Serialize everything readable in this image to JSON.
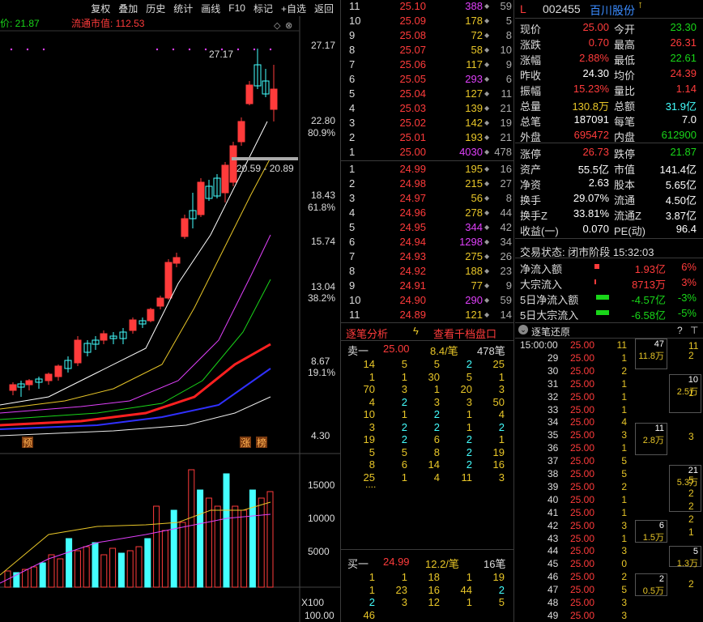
{
  "toolbar": [
    "复权",
    "叠加",
    "历史",
    "统计",
    "画线",
    "F10",
    "标记",
    "+自选",
    "返回"
  ],
  "chart": {
    "left_label": "价: 21.87",
    "market_cap_label": "流通市值: 112.53",
    "price_axis": [
      "27.17",
      "22.80",
      "18.43",
      "15.74",
      "13.04",
      "8.67",
      "4.30"
    ],
    "pct_axis": [
      "80.9%",
      "61.8%",
      "38.2%",
      "19.1%"
    ],
    "high_note": "27.17",
    "range_note": "20.59 - 20.89",
    "tags": [
      "预",
      "涨",
      "榜"
    ],
    "vol_axis": [
      "15000",
      "10000",
      "5000"
    ],
    "vol_unit": "X100",
    "osc_axis": "100.00"
  },
  "orderbook": {
    "asks": [
      {
        "lvl": "11",
        "px": "25.10",
        "vol": "388",
        "c": "59",
        "vc": "mag"
      },
      {
        "lvl": "10",
        "px": "25.09",
        "vol": "178",
        "c": "5",
        "vc": "yel"
      },
      {
        "lvl": "9",
        "px": "25.08",
        "vol": "72",
        "c": "8",
        "vc": "yel"
      },
      {
        "lvl": "8",
        "px": "25.07",
        "vol": "58",
        "c": "10",
        "vc": "yel"
      },
      {
        "lvl": "7",
        "px": "25.06",
        "vol": "117",
        "c": "9",
        "vc": "yel"
      },
      {
        "lvl": "6",
        "px": "25.05",
        "vol": "293",
        "c": "6",
        "vc": "mag"
      },
      {
        "lvl": "5",
        "px": "25.04",
        "vol": "127",
        "c": "11",
        "vc": "yel"
      },
      {
        "lvl": "4",
        "px": "25.03",
        "vol": "139",
        "c": "21",
        "vc": "yel"
      },
      {
        "lvl": "3",
        "px": "25.02",
        "vol": "142",
        "c": "19",
        "vc": "yel"
      },
      {
        "lvl": "2",
        "px": "25.01",
        "vol": "193",
        "c": "21",
        "vc": "yel"
      },
      {
        "lvl": "1",
        "px": "25.00",
        "vol": "4030",
        "c": "478",
        "vc": "mag"
      }
    ],
    "bids": [
      {
        "lvl": "1",
        "px": "24.99",
        "vol": "195",
        "c": "16",
        "vc": "yel"
      },
      {
        "lvl": "2",
        "px": "24.98",
        "vol": "215",
        "c": "27",
        "vc": "yel"
      },
      {
        "lvl": "3",
        "px": "24.97",
        "vol": "56",
        "c": "8",
        "vc": "yel"
      },
      {
        "lvl": "4",
        "px": "24.96",
        "vol": "278",
        "c": "44",
        "vc": "yel"
      },
      {
        "lvl": "5",
        "px": "24.95",
        "vol": "344",
        "c": "42",
        "vc": "mag"
      },
      {
        "lvl": "6",
        "px": "24.94",
        "vol": "1298",
        "c": "34",
        "vc": "mag"
      },
      {
        "lvl": "7",
        "px": "24.93",
        "vol": "275",
        "c": "26",
        "vc": "yel"
      },
      {
        "lvl": "8",
        "px": "24.92",
        "vol": "188",
        "c": "23",
        "vc": "yel"
      },
      {
        "lvl": "9",
        "px": "24.91",
        "vol": "77",
        "c": "9",
        "vc": "yel"
      },
      {
        "lvl": "10",
        "px": "24.90",
        "vol": "290",
        "c": "59",
        "vc": "mag"
      },
      {
        "lvl": "11",
        "px": "24.89",
        "vol": "121",
        "c": "14",
        "vc": "yel"
      }
    ]
  },
  "stats": {
    "badge": "L",
    "code": "002455",
    "name": "百川股份",
    "rows": [
      [
        "现价",
        "25.00",
        "red",
        "今开",
        "23.30",
        "grn"
      ],
      [
        "涨跌",
        "0.70",
        "red",
        "最高",
        "26.31",
        "red"
      ],
      [
        "涨幅",
        "2.88%",
        "red",
        "最低",
        "22.61",
        "grn"
      ],
      [
        "昨收",
        "24.30",
        "wht",
        "均价",
        "24.39",
        "red"
      ],
      [
        "振幅",
        "15.23%",
        "red",
        "量比",
        "1.14",
        "red"
      ],
      [
        "总量",
        "130.8万",
        "yel",
        "总额",
        "31.9亿",
        "cyn"
      ],
      [
        "总笔",
        "187091",
        "wht",
        "每笔",
        "7.0",
        "wht"
      ],
      [
        "外盘",
        "695472",
        "red",
        "内盘",
        "612900",
        "grn"
      ],
      [
        "涨停",
        "26.73",
        "red",
        "跌停",
        "21.87",
        "grn"
      ],
      [
        "资产",
        "55.5亿",
        "wht",
        "市值",
        "141.4亿",
        "wht"
      ],
      [
        "净资",
        "2.63",
        "wht",
        "股本",
        "5.65亿",
        "wht"
      ],
      [
        "换手",
        "29.07%",
        "wht",
        "流通",
        "4.50亿",
        "wht"
      ],
      [
        "换手Z",
        "33.81%",
        "wht",
        "流通Z",
        "3.87亿",
        "wht"
      ],
      [
        "收益(一)",
        "0.070",
        "wht",
        "PE(动)",
        "96.4",
        "wht"
      ]
    ],
    "trade_status": "交易状态: 闭市阶段 15:32:03",
    "flows": [
      [
        "净流入额",
        "1.93亿",
        "6%",
        "red"
      ],
      [
        "大宗流入",
        "8713万",
        "3%",
        "red"
      ],
      [
        "5日净流入额",
        "-4.57亿",
        "-3%",
        "grn"
      ],
      [
        "5日大宗流入",
        "-6.58亿",
        "-5%",
        "grn"
      ]
    ]
  },
  "tick": {
    "tab1": "逐笔分析",
    "tab2": "查看千档盘口",
    "sell_label": "卖一",
    "sell_px": "25.00",
    "sell_avg": "8.4/笔",
    "sell_cnt": "478笔",
    "sell_rows": [
      [
        [
          "14",
          "y"
        ],
        [
          "5",
          "y"
        ],
        [
          "5",
          "y"
        ],
        [
          "2",
          "c"
        ],
        [
          "25",
          "y"
        ]
      ],
      [
        [
          "1",
          "y"
        ],
        [
          "1",
          "y"
        ],
        [
          "30",
          "y"
        ],
        [
          "5",
          "y"
        ],
        [
          "1",
          "y"
        ]
      ],
      [
        [
          "70",
          "y"
        ],
        [
          "3",
          "y"
        ],
        [
          "1",
          "y"
        ],
        [
          "20",
          "y"
        ],
        [
          "3",
          "y"
        ]
      ],
      [
        [
          "4",
          "y"
        ],
        [
          "2",
          "c"
        ],
        [
          "3",
          "y"
        ],
        [
          "3",
          "y"
        ],
        [
          "50",
          "y"
        ]
      ],
      [
        [
          "10",
          "y"
        ],
        [
          "1",
          "y"
        ],
        [
          "2",
          "c"
        ],
        [
          "1",
          "y"
        ],
        [
          "4",
          "y"
        ]
      ],
      [
        [
          "3",
          "y"
        ],
        [
          "2",
          "c"
        ],
        [
          "2",
          "c"
        ],
        [
          "1",
          "y"
        ],
        [
          "2",
          "c"
        ]
      ],
      [
        [
          "19",
          "y"
        ],
        [
          "2",
          "c"
        ],
        [
          "6",
          "y"
        ],
        [
          "2",
          "c"
        ],
        [
          "1",
          "y"
        ]
      ],
      [
        [
          "5",
          "y"
        ],
        [
          "5",
          "y"
        ],
        [
          "8",
          "y"
        ],
        [
          "2",
          "c"
        ],
        [
          "19",
          "y"
        ]
      ],
      [
        [
          "8",
          "y"
        ],
        [
          "6",
          "y"
        ],
        [
          "14",
          "y"
        ],
        [
          "2",
          "c"
        ],
        [
          "16",
          "y"
        ]
      ],
      [
        [
          "25",
          "y"
        ],
        [
          "1",
          "y"
        ],
        [
          "4",
          "y"
        ],
        [
          "11",
          "y"
        ],
        [
          "3",
          "y"
        ]
      ]
    ],
    "dots": "....",
    "buy_label": "买一",
    "buy_px": "24.99",
    "buy_avg": "12.2/笔",
    "buy_cnt": "16笔",
    "buy_rows": [
      [
        [
          "1",
          "y"
        ],
        [
          "1",
          "y"
        ],
        [
          "18",
          "y"
        ],
        [
          "1",
          "y"
        ],
        [
          "19",
          "y"
        ]
      ],
      [
        [
          "1",
          "y"
        ],
        [
          "23",
          "y"
        ],
        [
          "16",
          "y"
        ],
        [
          "44",
          "y"
        ],
        [
          "2",
          "c"
        ]
      ],
      [
        [
          "2",
          "c"
        ],
        [
          "3",
          "y"
        ],
        [
          "12",
          "y"
        ],
        [
          "1",
          "y"
        ],
        [
          "5",
          "y"
        ]
      ],
      [
        [
          "46",
          "y"
        ],
        [
          "",
          "y"
        ],
        [
          "",
          "y"
        ],
        [
          "",
          "y"
        ],
        [
          "",
          "y"
        ]
      ]
    ]
  },
  "trades": {
    "title": "逐笔还原",
    "help": "?",
    "rows": [
      [
        "15:00:00",
        "25.00",
        "11"
      ],
      [
        "29",
        "25.00",
        "1"
      ],
      [
        "30",
        "25.00",
        "2"
      ],
      [
        "31",
        "25.00",
        "1"
      ],
      [
        "32",
        "25.00",
        "1"
      ],
      [
        "33",
        "25.00",
        "1"
      ],
      [
        "34",
        "25.00",
        "4"
      ],
      [
        "35",
        "25.00",
        "3"
      ],
      [
        "36",
        "25.00",
        "1"
      ],
      [
        "37",
        "25.00",
        "5"
      ],
      [
        "38",
        "25.00",
        "5"
      ],
      [
        "39",
        "25.00",
        "2"
      ],
      [
        "40",
        "25.00",
        "1"
      ],
      [
        "41",
        "25.00",
        "1"
      ],
      [
        "42",
        "25.00",
        "3"
      ],
      [
        "43",
        "25.00",
        "1"
      ],
      [
        "44",
        "25.00",
        "3"
      ],
      [
        "45",
        "25.00",
        "0"
      ],
      [
        "46",
        "25.00",
        "2"
      ],
      [
        "47",
        "25.00",
        "5"
      ],
      [
        "48",
        "25.00",
        "3"
      ],
      [
        "49",
        "25.00",
        "3"
      ]
    ],
    "boxes": [
      {
        "a": "47",
        "b": "11.8万"
      },
      {
        "a": "10",
        "b": "2.5万"
      },
      {
        "a": "11",
        "b": "2.8万"
      },
      {
        "a": "21",
        "b": "5.3万"
      },
      {
        "a": "6",
        "b": "1.5万"
      },
      {
        "a": "5",
        "b": "1.3万"
      },
      {
        "a": "2",
        "b": "0.5万"
      }
    ],
    "right": [
      "11",
      "2",
      "1",
      "3",
      "5",
      "2",
      "2",
      "2",
      "1",
      "2"
    ]
  }
}
